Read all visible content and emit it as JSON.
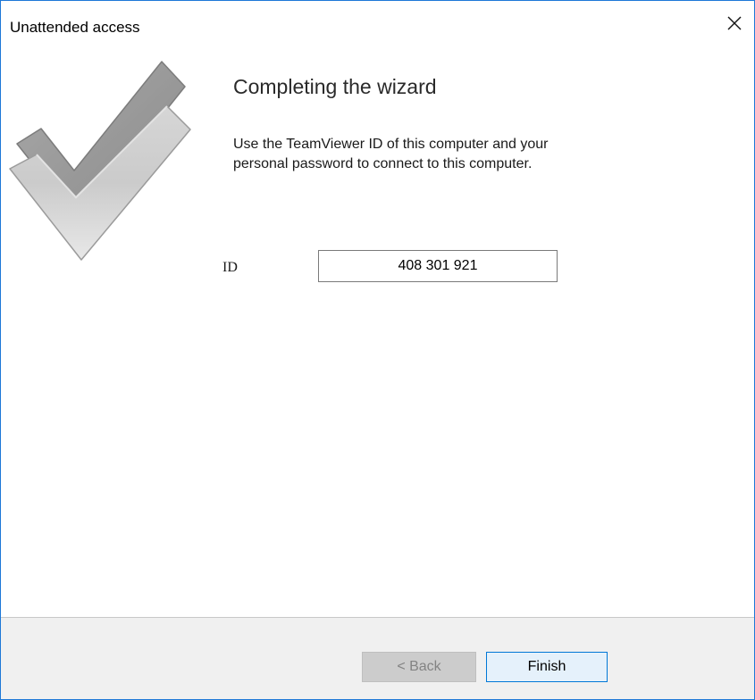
{
  "window": {
    "title": "Unattended access",
    "close_icon": "close-icon",
    "accent_color": "#1e78d7"
  },
  "wizard": {
    "heading": "Completing the wizard",
    "description_line1": "Use the TeamViewer ID of this computer and your",
    "description_line2": "personal password to connect to this computer.",
    "illustration_icon": "checkmark-icon"
  },
  "id_field": {
    "label": "ID",
    "value": "408 301 921"
  },
  "footer": {
    "back_label": "< Back",
    "back_enabled": false,
    "finish_label": "Finish"
  }
}
